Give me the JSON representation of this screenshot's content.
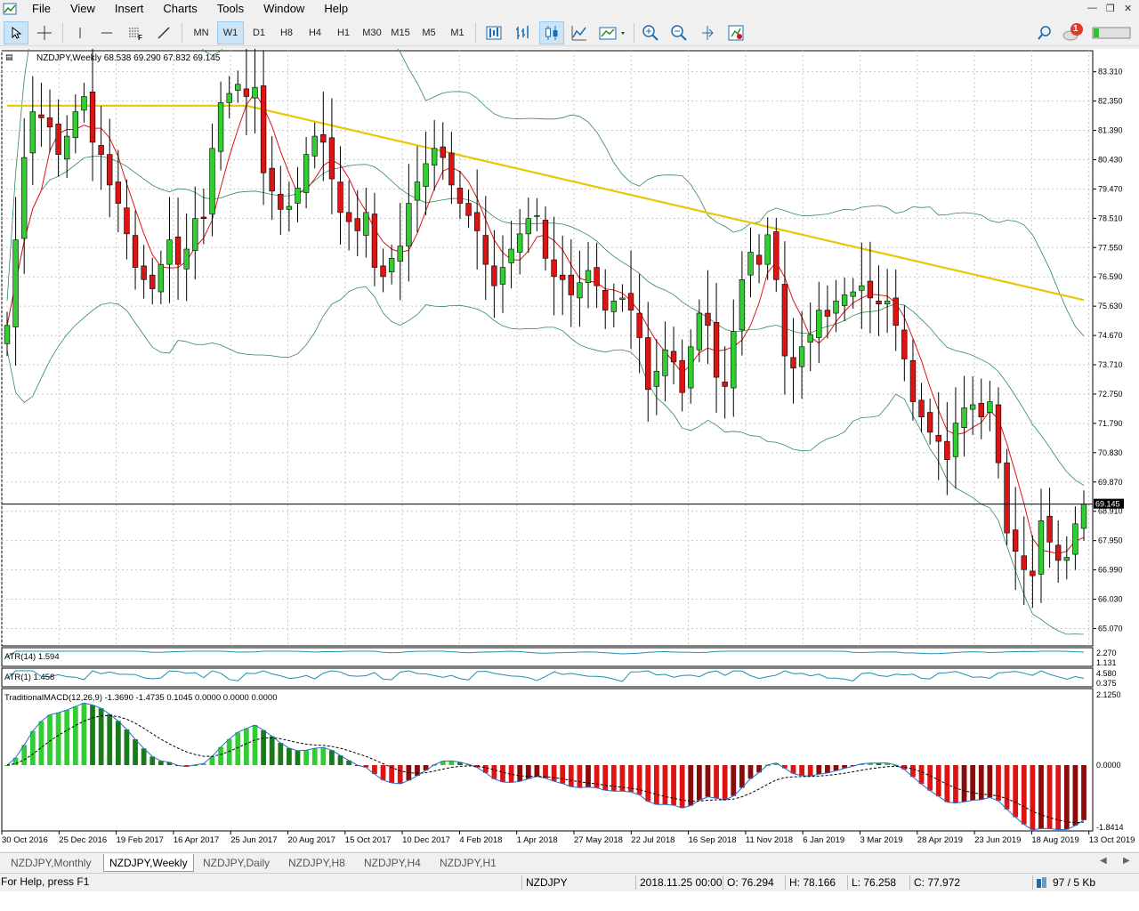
{
  "menu": [
    "File",
    "View",
    "Insert",
    "Charts",
    "Tools",
    "Window",
    "Help"
  ],
  "toolbar": {
    "timeframes": [
      "MN",
      "W1",
      "D1",
      "H8",
      "H4",
      "H1",
      "M30",
      "M15",
      "M5",
      "M1"
    ],
    "active_timeframe": "W1",
    "notification_count": "1"
  },
  "chart": {
    "header": "NZDJPY,Weekly  68.538 69.290 67.832 69.145",
    "current_price": "69.145",
    "price_axis": [
      "83.310",
      "82.350",
      "81.390",
      "80.430",
      "79.470",
      "78.510",
      "77.550",
      "76.590",
      "75.630",
      "74.670",
      "73.710",
      "72.750",
      "71.790",
      "70.830",
      "69.870",
      "68.910",
      "67.950",
      "66.990",
      "66.030",
      "65.070"
    ],
    "date_axis": [
      "30 Oct 2016",
      "25 Dec 2016",
      "19 Feb 2017",
      "16 Apr 2017",
      "25 Jun 2017",
      "20 Aug 2017",
      "15 Oct 2017",
      "10 Dec 2017",
      "4 Feb 2018",
      "1 Apr 2018",
      "27 May 2018",
      "22 Jul 2018",
      "16 Sep 2018",
      "11 Nov 2018",
      "6 Jan 2019",
      "3 Mar 2019",
      "28 Apr 2019",
      "23 Jun 2019",
      "18 Aug 2019",
      "13 Oct 2019"
    ],
    "colors": {
      "bull": "#32cd32",
      "bear": "#dc1414",
      "ma_long": "#e8c800",
      "ma_short": "#dc1414",
      "bands": "#2e8b57"
    }
  },
  "indicators": {
    "atr14": {
      "label": "ATR(14) 1.594",
      "scale": [
        "2.270",
        "1.131"
      ]
    },
    "atr1": {
      "label": "ATR(1) 1.458",
      "scale": [
        "4.580",
        "0.375"
      ]
    },
    "macd": {
      "label": "TraditionalMACD(12,26,9) -1.3690 -1.4735 0.1045 0.0000 0.0000 0.0000",
      "scale": [
        "2.1250",
        "0.0000",
        "-1.8414"
      ]
    }
  },
  "tabs": [
    "NZDJPY,Monthly",
    "NZDJPY,Weekly",
    "NZDJPY,Daily",
    "NZDJPY,H8",
    "NZDJPY,H4",
    "NZDJPY,H1"
  ],
  "active_tab": "NZDJPY,Weekly",
  "status": {
    "help": "For Help, press F1",
    "symbol": "NZDJPY",
    "datetime": "2018.11.25 00:00",
    "open": "O: 76.294",
    "high": "H: 78.166",
    "low": "L: 76.258",
    "close": "C: 77.972",
    "traffic": "97 / 5 Kb"
  },
  "chart_data": {
    "type": "candlestick",
    "symbol": "NZDJPY",
    "timeframe": "Weekly",
    "ylim": [
      64.5,
      84.0
    ],
    "closes": [
      75.0,
      77.8,
      80.5,
      82.0,
      81.8,
      81.5,
      80.6,
      81.2,
      82.0,
      82.5,
      81.0,
      80.6,
      79.6,
      79.0,
      78.0,
      76.9,
      76.5,
      76.2,
      77.0,
      77.8,
      77.0,
      77.5,
      78.5,
      78.5,
      80.8,
      82.3,
      82.6,
      82.9,
      82.5,
      82.8,
      80.0,
      79.4,
      78.8,
      78.9,
      79.5,
      80.6,
      81.2,
      81.0,
      79.8,
      78.7,
      78.4,
      78.1,
      78.7,
      76.9,
      76.6,
      77.2,
      77.6,
      79.0,
      79.7,
      80.3,
      80.8,
      80.5,
      79.6,
      79.0,
      78.6,
      78.1,
      77.0,
      76.3,
      76.9,
      77.5,
      78.0,
      78.5,
      78.6,
      77.2,
      76.6,
      76.5,
      76.0,
      76.4,
      76.8,
      76.3,
      75.5,
      75.8,
      75.9,
      75.5,
      74.6,
      72.9,
      73.5,
      74.2,
      73.8,
      72.8,
      74.3,
      75.4,
      75.0,
      73.3,
      73.0,
      74.8,
      76.5,
      77.4,
      77.0,
      77.97,
      76.5,
      74.0,
      73.6,
      74.3,
      74.7,
      75.5,
      75.3,
      75.8,
      76.0,
      76.1,
      76.3,
      75.9,
      75.7,
      75.8,
      75.0,
      73.9,
      72.5,
      72.0,
      71.5,
      71.2,
      70.6,
      71.8,
      72.3,
      72.4,
      72.0,
      72.5,
      70.5,
      68.2,
      67.6,
      67.0,
      66.8,
      68.6,
      67.9,
      67.3,
      67.4,
      68.5,
      69.145
    ]
  }
}
